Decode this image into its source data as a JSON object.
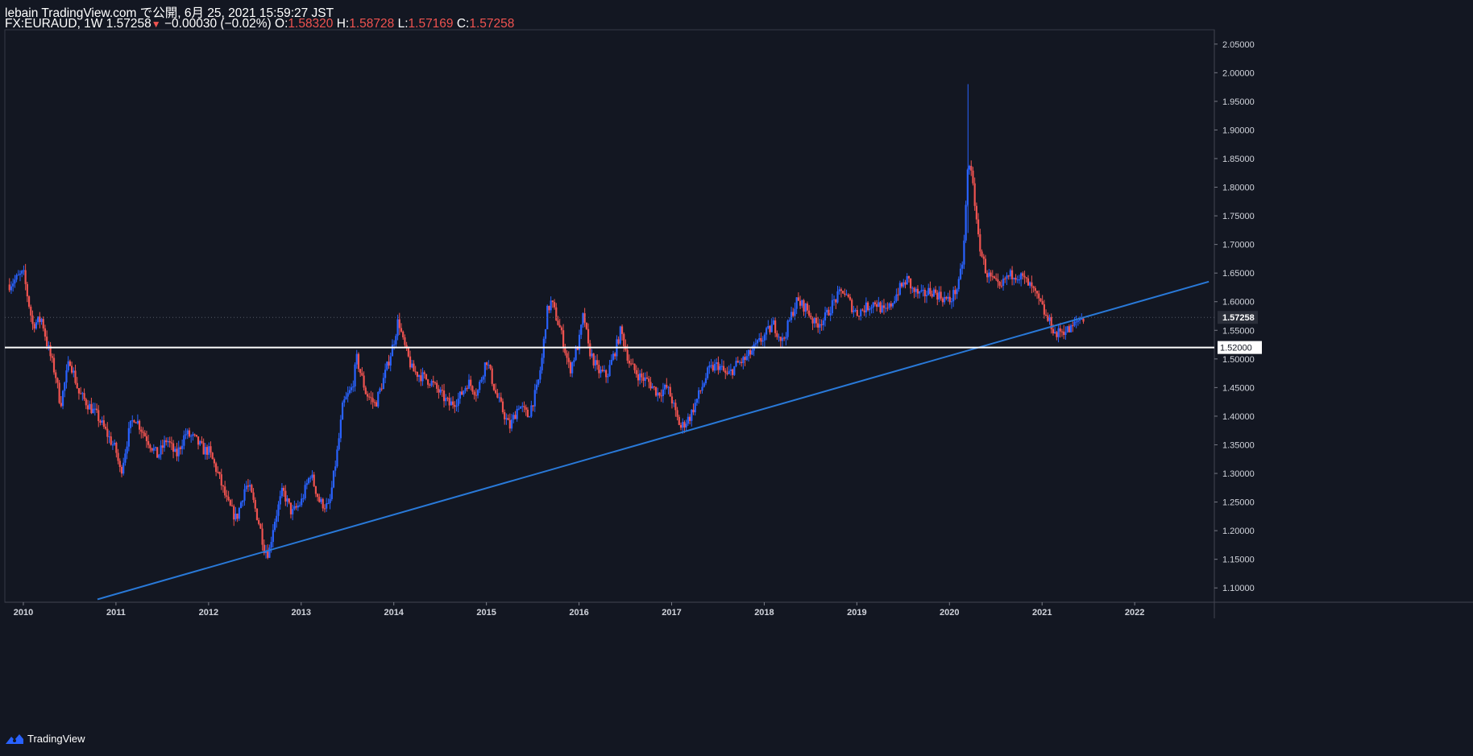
{
  "header": {
    "line1": "lebain TradingView.com で公開, 6月 25, 2021 15:59:27 JST",
    "symbol": "FX:EURAUD, 1W",
    "last": "1.57258",
    "change_arrow": "▼",
    "change": "−0.00030 (−0.02%)",
    "o_label": "O:",
    "o_val": "1.58320",
    "h_label": "H:",
    "h_val": "1.58728",
    "l_label": "L:",
    "l_val": "1.57169",
    "c_label": "C:",
    "c_val": "1.57258"
  },
  "footer": {
    "brand": "TradingView",
    "logo_icon": "tradingview-logo-icon"
  },
  "colors": {
    "background": "#131722",
    "up": "#2962ff",
    "down": "#ef5350",
    "trendline": "#2979d8",
    "hline": "#ffffff",
    "text": "#d1d4dc"
  },
  "chart_data": {
    "type": "candlestick",
    "symbol": "FX:EURAUD",
    "interval": "1W",
    "ylim": [
      1.075,
      2.075
    ],
    "y_ticks": [
      "2.05000",
      "2.00000",
      "1.95000",
      "1.90000",
      "1.85000",
      "1.80000",
      "1.75000",
      "1.70000",
      "1.65000",
      "1.60000",
      "1.55000",
      "1.50000",
      "1.45000",
      "1.40000",
      "1.35000",
      "1.30000",
      "1.25000",
      "1.20000",
      "1.15000",
      "1.10000"
    ],
    "x_ticks": [
      "2010",
      "2011",
      "2012",
      "2013",
      "2014",
      "2015",
      "2016",
      "2017",
      "2018",
      "2019",
      "2020",
      "2021",
      "2022"
    ],
    "last_price_label": "1.57258",
    "hline": {
      "value": 1.52,
      "label": "1.52000"
    },
    "trendline": [
      [
        2010.8,
        1.08
      ],
      [
        2022.8,
        1.635
      ]
    ],
    "price_path": [
      [
        2009.85,
        1.63
      ],
      [
        2010.0,
        1.65
      ],
      [
        2010.1,
        1.56
      ],
      [
        2010.2,
        1.57
      ],
      [
        2010.25,
        1.53
      ],
      [
        2010.35,
        1.47
      ],
      [
        2010.4,
        1.42
      ],
      [
        2010.5,
        1.5
      ],
      [
        2010.6,
        1.44
      ],
      [
        2010.7,
        1.42
      ],
      [
        2010.8,
        1.4
      ],
      [
        2010.9,
        1.37
      ],
      [
        2011.0,
        1.34
      ],
      [
        2011.05,
        1.3
      ],
      [
        2011.15,
        1.38
      ],
      [
        2011.2,
        1.4
      ],
      [
        2011.3,
        1.37
      ],
      [
        2011.45,
        1.33
      ],
      [
        2011.55,
        1.36
      ],
      [
        2011.65,
        1.33
      ],
      [
        2011.75,
        1.37
      ],
      [
        2011.85,
        1.36
      ],
      [
        2011.95,
        1.34
      ],
      [
        2012.0,
        1.34
      ],
      [
        2012.1,
        1.3
      ],
      [
        2012.2,
        1.25
      ],
      [
        2012.3,
        1.22
      ],
      [
        2012.4,
        1.28
      ],
      [
        2012.45,
        1.27
      ],
      [
        2012.55,
        1.21
      ],
      [
        2012.6,
        1.17
      ],
      [
        2012.65,
        1.16
      ],
      [
        2012.7,
        1.21
      ],
      [
        2012.8,
        1.27
      ],
      [
        2012.9,
        1.23
      ],
      [
        2013.0,
        1.25
      ],
      [
        2013.1,
        1.3
      ],
      [
        2013.2,
        1.25
      ],
      [
        2013.3,
        1.24
      ],
      [
        2013.4,
        1.35
      ],
      [
        2013.45,
        1.42
      ],
      [
        2013.55,
        1.45
      ],
      [
        2013.6,
        1.5
      ],
      [
        2013.7,
        1.44
      ],
      [
        2013.8,
        1.42
      ],
      [
        2013.9,
        1.47
      ],
      [
        2014.0,
        1.53
      ],
      [
        2014.05,
        1.57
      ],
      [
        2014.1,
        1.53
      ],
      [
        2014.2,
        1.48
      ],
      [
        2014.3,
        1.47
      ],
      [
        2014.4,
        1.46
      ],
      [
        2014.5,
        1.44
      ],
      [
        2014.6,
        1.42
      ],
      [
        2014.7,
        1.43
      ],
      [
        2014.8,
        1.46
      ],
      [
        2014.9,
        1.44
      ],
      [
        2015.0,
        1.5
      ],
      [
        2015.1,
        1.44
      ],
      [
        2015.2,
        1.4
      ],
      [
        2015.25,
        1.38
      ],
      [
        2015.35,
        1.42
      ],
      [
        2015.45,
        1.4
      ],
      [
        2015.55,
        1.45
      ],
      [
        2015.6,
        1.5
      ],
      [
        2015.65,
        1.58
      ],
      [
        2015.7,
        1.6
      ],
      [
        2015.8,
        1.55
      ],
      [
        2015.9,
        1.48
      ],
      [
        2016.0,
        1.53
      ],
      [
        2016.05,
        1.58
      ],
      [
        2016.1,
        1.52
      ],
      [
        2016.2,
        1.48
      ],
      [
        2016.3,
        1.47
      ],
      [
        2016.4,
        1.52
      ],
      [
        2016.45,
        1.55
      ],
      [
        2016.55,
        1.49
      ],
      [
        2016.65,
        1.47
      ],
      [
        2016.75,
        1.46
      ],
      [
        2016.85,
        1.44
      ],
      [
        2016.95,
        1.45
      ],
      [
        2017.0,
        1.43
      ],
      [
        2017.05,
        1.4
      ],
      [
        2017.1,
        1.38
      ],
      [
        2017.2,
        1.4
      ],
      [
        2017.3,
        1.44
      ],
      [
        2017.4,
        1.48
      ],
      [
        2017.5,
        1.49
      ],
      [
        2017.6,
        1.47
      ],
      [
        2017.7,
        1.49
      ],
      [
        2017.8,
        1.5
      ],
      [
        2017.9,
        1.52
      ],
      [
        2018.0,
        1.54
      ],
      [
        2018.1,
        1.56
      ],
      [
        2018.2,
        1.53
      ],
      [
        2018.3,
        1.58
      ],
      [
        2018.35,
        1.6
      ],
      [
        2018.45,
        1.59
      ],
      [
        2018.55,
        1.56
      ],
      [
        2018.65,
        1.57
      ],
      [
        2018.75,
        1.6
      ],
      [
        2018.85,
        1.62
      ],
      [
        2018.95,
        1.59
      ],
      [
        2019.0,
        1.58
      ],
      [
        2019.1,
        1.59
      ],
      [
        2019.2,
        1.6
      ],
      [
        2019.3,
        1.58
      ],
      [
        2019.35,
        1.59
      ],
      [
        2019.45,
        1.62
      ],
      [
        2019.55,
        1.64
      ],
      [
        2019.6,
        1.62
      ],
      [
        2019.7,
        1.61
      ],
      [
        2019.8,
        1.62
      ],
      [
        2019.9,
        1.61
      ],
      [
        2020.0,
        1.6
      ],
      [
        2020.1,
        1.63
      ],
      [
        2020.15,
        1.68
      ],
      [
        2020.2,
        1.84
      ],
      [
        2020.25,
        1.82
      ],
      [
        2020.3,
        1.72
      ],
      [
        2020.35,
        1.68
      ],
      [
        2020.4,
        1.65
      ],
      [
        2020.5,
        1.63
      ],
      [
        2020.55,
        1.62
      ],
      [
        2020.6,
        1.64
      ],
      [
        2020.7,
        1.65
      ],
      [
        2020.8,
        1.64
      ],
      [
        2020.9,
        1.62
      ],
      [
        2021.0,
        1.59
      ],
      [
        2021.05,
        1.57
      ],
      [
        2021.1,
        1.56
      ],
      [
        2021.15,
        1.54
      ],
      [
        2021.2,
        1.55
      ],
      [
        2021.3,
        1.55
      ],
      [
        2021.35,
        1.56
      ],
      [
        2021.4,
        1.57
      ],
      [
        2021.45,
        1.572
      ]
    ]
  }
}
